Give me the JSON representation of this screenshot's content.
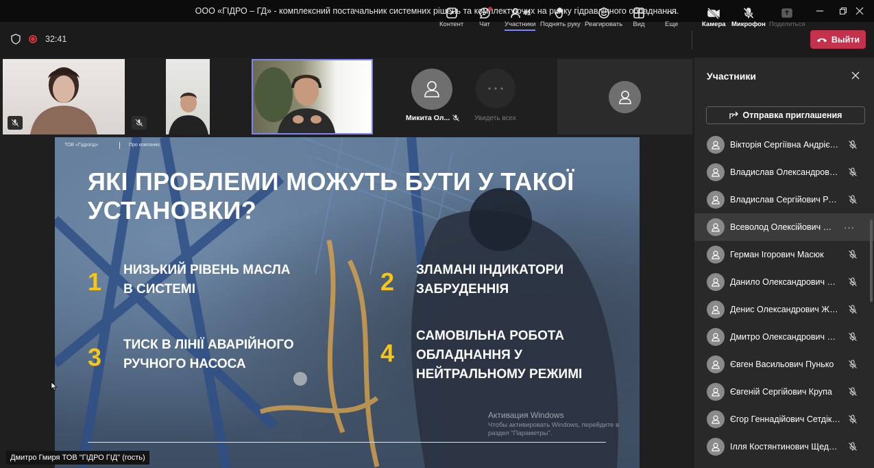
{
  "window": {
    "title": "ООО «ГІДРО – ГД» - комплексний постачальник системних рішень та комплектуючих на ринку гідравлічного обладнання."
  },
  "toolbar": {
    "timer": "32:41",
    "content_label": "Контент",
    "chat_label": "Чат",
    "participants_label": "Участники",
    "participants_count": "41",
    "raise_hand_label": "Поднять руку",
    "react_label": "Реагировать",
    "view_label": "Вид",
    "more_label": "Еще",
    "camera_label": "Камера",
    "mic_label": "Микрофон",
    "share_label": "Поделиться",
    "leave_label": "Выйти",
    "leave_color": "#c4314b"
  },
  "gallery": {
    "tile4_name": "Микита Ол...",
    "tile5_label": "Увидеть всех"
  },
  "slide": {
    "header_left": "ТОВ «Гідрогід»",
    "header_right": "Про компанію",
    "title": "ЯКІ ПРОБЛЕМИ МОЖУТЬ БУТИ У ТАКОЇ УСТАНОВКИ?",
    "items": [
      {
        "num": "1",
        "text": "НИЗЬКИЙ РІВЕНЬ МАСЛА В СИСТЕМІ"
      },
      {
        "num": "2",
        "text": "ЗЛАМАНІ ІНДИКАТОРИ ЗАБРУДЕННІЯ"
      },
      {
        "num": "3",
        "text": "ТИСК В ЛІНІЇ АВАРІЙНОГО РУЧНОГО НАСОСА"
      },
      {
        "num": "4",
        "text": "САМОВІЛЬНА РОБОТА ОБЛАДНАННЯ У НЕЙТРАЛЬНОМУ РЕЖИМІ"
      }
    ],
    "accent_color": "#f5c518",
    "activation_title": "Активация Windows",
    "activation_text": "Чтобы активировать Windows, перейдите в раздел \"Параметры\"."
  },
  "presenter": {
    "name": "Дмитро Гмиря ТОВ \"ГІДРО ГІД\" (гость)"
  },
  "panel": {
    "title": "Участники",
    "invite_label": "Отправка приглашения",
    "participants": [
      "Вікторія Сергіївна Андрієвська",
      "Владислав Олександрович Б...",
      "Владислав Сергійович Ракит...",
      "Всеволод Олексійович Мо...",
      "Герман Ігорович Масюк",
      "Данило Олександрович Сок...",
      "Денис Олександрович Жанд...",
      "Дмитро Олександрович Виб...",
      "Євген Васильович Пунько",
      "Євгеній Сергійович Крупа",
      "Єгор Геннадійович Сетдіков",
      "Ілля Костянтинович Щедрин..."
    ]
  }
}
